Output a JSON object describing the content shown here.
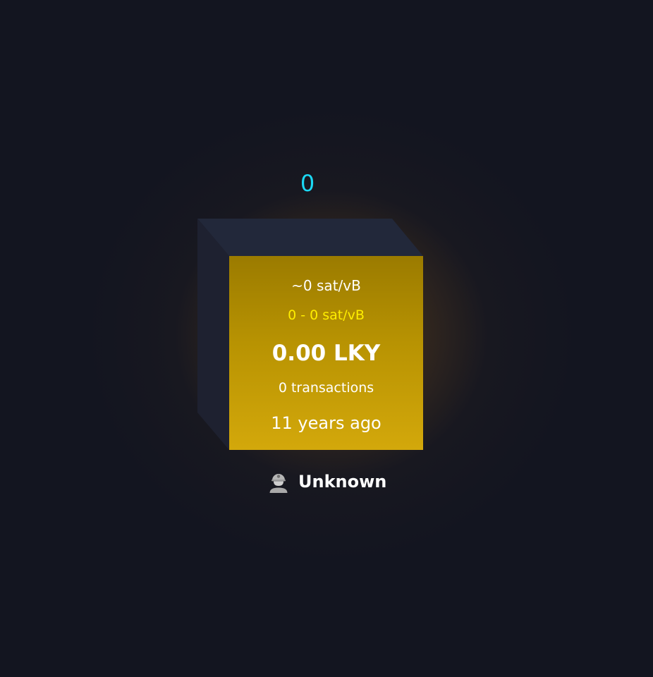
{
  "block": {
    "height": "0",
    "median_fee": "~0 sat/vB",
    "fee_range": "0 - 0 sat/vB",
    "total_value": "0.00 LKY",
    "transactions": "0 transactions",
    "time_ago": "11 years ago"
  },
  "miner": {
    "name": "Unknown",
    "icon": "miner-avatar-icon"
  },
  "colors": {
    "background": "#131520",
    "block_height": "#1bd8f4",
    "block_face_top": "#9b7b00",
    "block_face_bottom": "#d3a80b",
    "fee_range": "#ffee00",
    "cube_side": "#1e2130",
    "cube_top": "#22283a",
    "glow": "#b9781e"
  }
}
